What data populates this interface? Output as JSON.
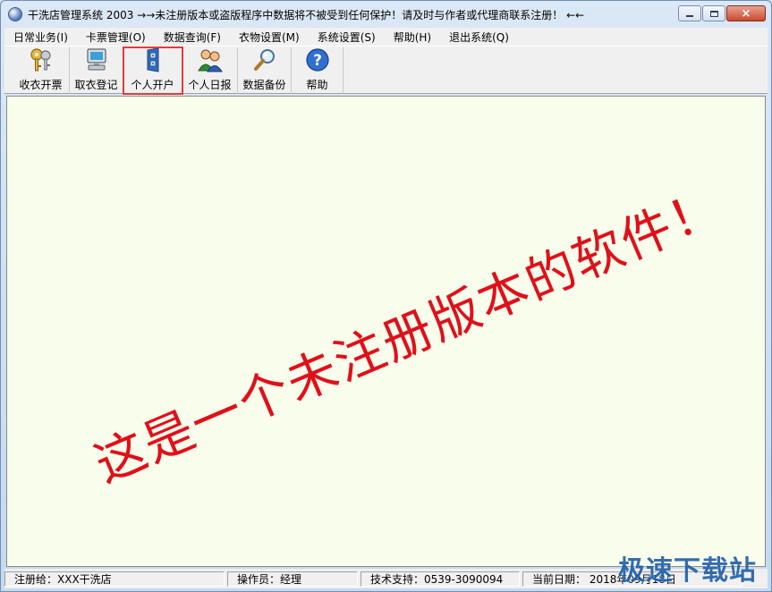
{
  "window": {
    "title": "干洗店管理系统 2003  →→未注册版本或盗版程序中数据将不被受到任何保护！请及时与作者或代理商联系注册！ ←←",
    "close_glyph": "×"
  },
  "menu": [
    {
      "label": "日常业务(I)"
    },
    {
      "label": "卡票管理(O)"
    },
    {
      "label": "数据查询(F)"
    },
    {
      "label": "衣物设置(M)"
    },
    {
      "label": "系统设置(S)"
    },
    {
      "label": "帮助(H)"
    },
    {
      "label": "退出系统(Q)"
    }
  ],
  "toolbar": [
    {
      "label": "收衣开票",
      "icon": "keys-icon"
    },
    {
      "label": "取衣登记",
      "icon": "computer-icon"
    },
    {
      "label": "个人开户",
      "icon": "cabinet-icon",
      "selected": true
    },
    {
      "label": "个人日报",
      "icon": "users-icon"
    },
    {
      "label": "数据备份",
      "icon": "magnifier-icon"
    },
    {
      "label": "帮助",
      "icon": "help-icon"
    }
  ],
  "watermark": "这是一个未注册版本的软件！",
  "status": {
    "registered_to": "注册给：XXX干洗店",
    "operator": "操作员：经理",
    "support": "技术支持：0539-3090094",
    "date": "当前日期： 2018年09月18日"
  },
  "brand": "极速下载站",
  "colors": {
    "watermark": "#e0101a",
    "client_bg": "#f9fdec",
    "selection_outline": "#e33b3b",
    "brand": "#1f5ea8"
  }
}
